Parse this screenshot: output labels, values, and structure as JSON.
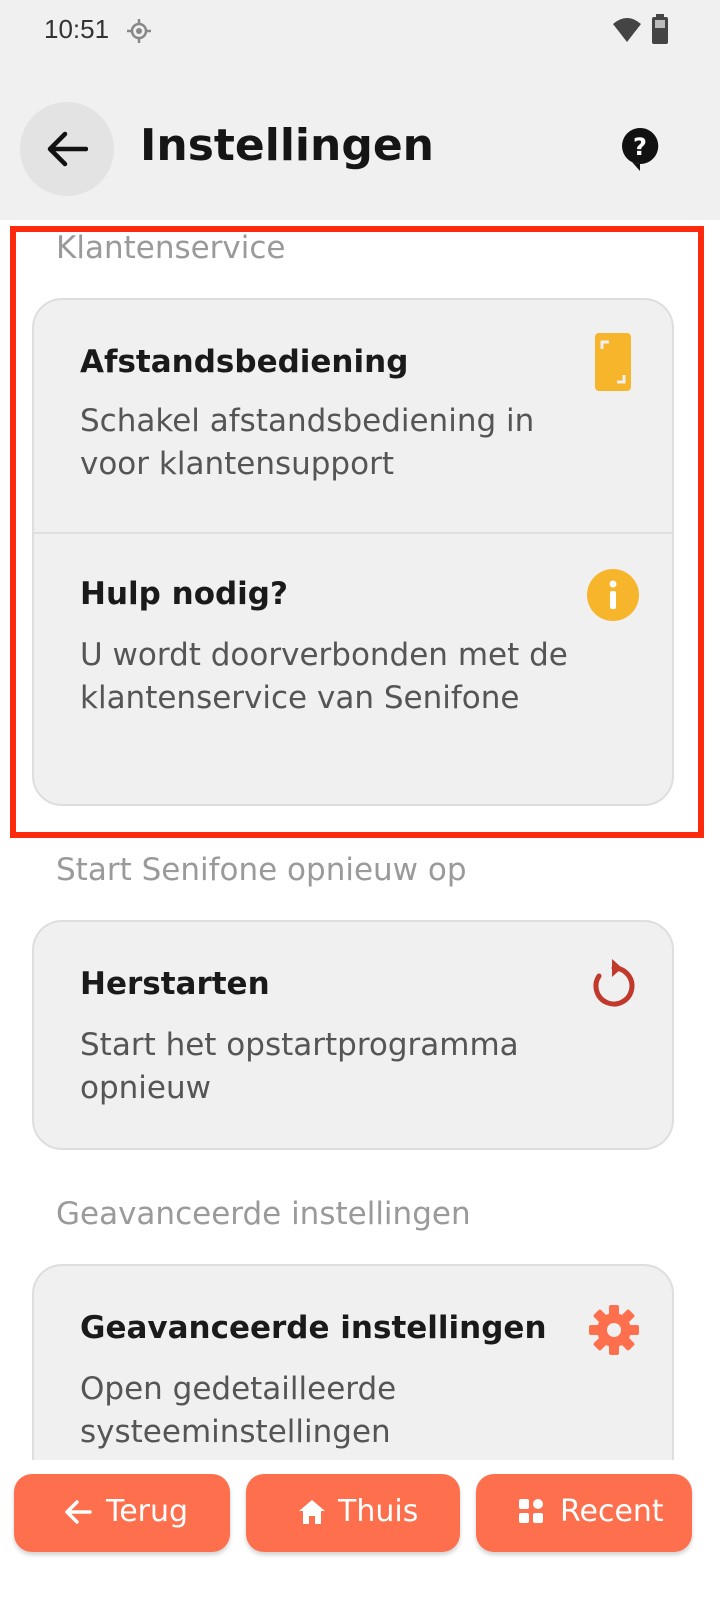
{
  "status_bar": {
    "time": "10:51"
  },
  "header": {
    "title": "Instellingen"
  },
  "sections": [
    {
      "title": "Klantenservice",
      "items": [
        {
          "title": "Afstandsbediening",
          "description": "Schakel afstandsbediening in voor klantensupport",
          "icon": "remote-phone-icon"
        },
        {
          "title": "Hulp nodig?",
          "description": "U wordt doorverbonden met de klantenservice van Senifone",
          "icon": "info-icon"
        }
      ]
    },
    {
      "title": "Start Senifone opnieuw op",
      "items": [
        {
          "title": "Herstarten",
          "description": "Start het opstartprogramma opnieuw",
          "icon": "restart-icon"
        }
      ]
    },
    {
      "title": "Geavanceerde instellingen",
      "items": [
        {
          "title": "Geavanceerde instellingen",
          "description": "Open gedetailleerde systeeminstellingen",
          "icon": "gear-icon"
        }
      ]
    }
  ],
  "bottom_nav": {
    "back_label": "Terug",
    "home_label": "Thuis",
    "recent_label": "Recent"
  },
  "colors": {
    "accent": "#fe6f4d",
    "highlight": "#ff2a0e",
    "yellow": "#f7b52c",
    "restart": "#c0392b"
  }
}
